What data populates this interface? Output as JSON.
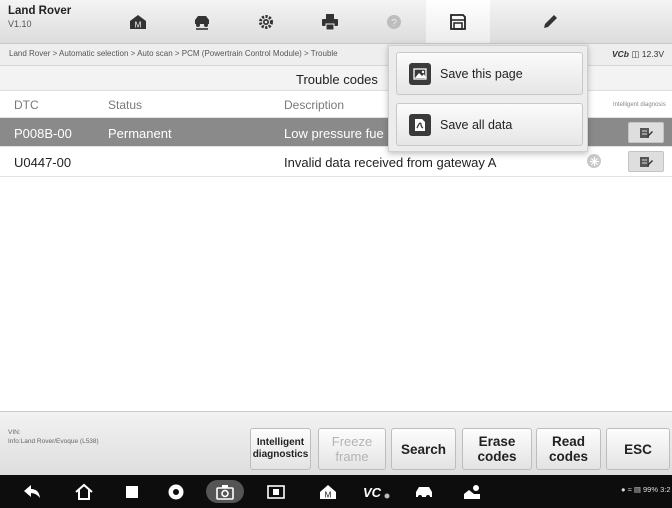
{
  "app": {
    "name": "Land Rover",
    "version": "V1.10"
  },
  "toolbar": {
    "tools": [
      "home-icon",
      "vehicle-swap-icon",
      "settings-icon",
      "print-icon",
      "help-icon",
      "save-icon",
      "edit-icon"
    ],
    "selected": "save-icon"
  },
  "breadcrumb": "Land Rover > Automatic selection > Auto scan > PCM (Powertrain Control Module) > Trouble",
  "vci": {
    "label": "VCb",
    "value": "12.3V"
  },
  "page_title": "Trouble codes",
  "table": {
    "headers": {
      "dtc": "DTC",
      "status": "Status",
      "description": "Description",
      "action": "Intelligent diagnosis"
    },
    "rows": [
      {
        "dtc": "P008B-00",
        "status": "Permanent",
        "description": "Low pressure fue",
        "selected": true,
        "freeze_frame": false
      },
      {
        "dtc": "U0447-00",
        "status": "",
        "description": "Invalid data received from gateway  A",
        "selected": false,
        "freeze_frame": true
      }
    ]
  },
  "save_menu": {
    "save_page": "Save this page",
    "save_all": "Save all data"
  },
  "vehicle_info": {
    "vin_label": "VIN:",
    "info": "Info:Land Rover/Evoque (L538)"
  },
  "functions": {
    "intelligent": "Intelligent diagnostics",
    "freeze": "Freeze frame",
    "search": "Search",
    "erase": "Erase codes",
    "read": "Read codes",
    "esc": "ESC"
  },
  "system_status": "99% 3:2",
  "colors": {
    "selected_row": "#8a8a8a",
    "toolbar": "#dcdcdc",
    "navbar": "#0d0d0d"
  }
}
